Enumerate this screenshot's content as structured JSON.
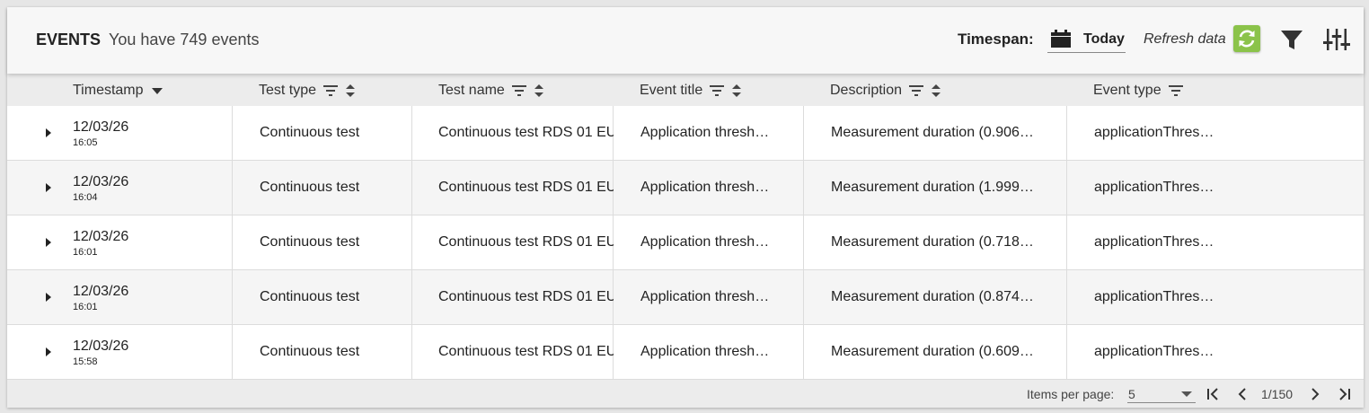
{
  "header": {
    "title": "EVENTS",
    "subtitle": "You have 749 events",
    "timespan_label": "Timespan:",
    "timespan_value": "Today",
    "refresh_label": "Refresh data",
    "icons": [
      "calendar-icon",
      "refresh-icon",
      "filter-icon",
      "settings-sliders-icon"
    ],
    "refresh_color": "#8bc34a"
  },
  "columns": [
    {
      "label": "Timestamp",
      "sort": "desc",
      "filter": false
    },
    {
      "label": "Test type",
      "sort": "both",
      "filter": true
    },
    {
      "label": "Test name",
      "sort": "both",
      "filter": true
    },
    {
      "label": "Event title",
      "sort": "both",
      "filter": true
    },
    {
      "label": "Description",
      "sort": "both",
      "filter": true
    },
    {
      "label": "Event type",
      "sort": "none",
      "filter": true
    }
  ],
  "rows": [
    {
      "date": "12/03/26",
      "time": "16:05",
      "test_type": "Continuous test",
      "test_name": "Continuous test RDS 01 EU",
      "event_title": "Application thresh…",
      "description": "Measurement duration (0.906…",
      "event_type": "applicationThres…"
    },
    {
      "date": "12/03/26",
      "time": "16:04",
      "test_type": "Continuous test",
      "test_name": "Continuous test RDS 01 EU",
      "event_title": "Application thresh…",
      "description": "Measurement duration (1.999…",
      "event_type": "applicationThres…"
    },
    {
      "date": "12/03/26",
      "time": "16:01",
      "test_type": "Continuous test",
      "test_name": "Continuous test RDS 01 EU",
      "event_title": "Application thresh…",
      "description": "Measurement duration (0.718…",
      "event_type": "applicationThres…"
    },
    {
      "date": "12/03/26",
      "time": "16:01",
      "test_type": "Continuous test",
      "test_name": "Continuous test RDS 01 EU",
      "event_title": "Application thresh…",
      "description": "Measurement duration (0.874…",
      "event_type": "applicationThres…"
    },
    {
      "date": "12/03/26",
      "time": "15:58",
      "test_type": "Continuous test",
      "test_name": "Continuous test RDS 01 EU",
      "event_title": "Application thresh…",
      "description": "Measurement duration (0.609…",
      "event_type": "applicationThres…"
    }
  ],
  "footer": {
    "items_per_page_label": "Items per page:",
    "items_per_page_value": "5",
    "page_indicator": "1/150"
  }
}
